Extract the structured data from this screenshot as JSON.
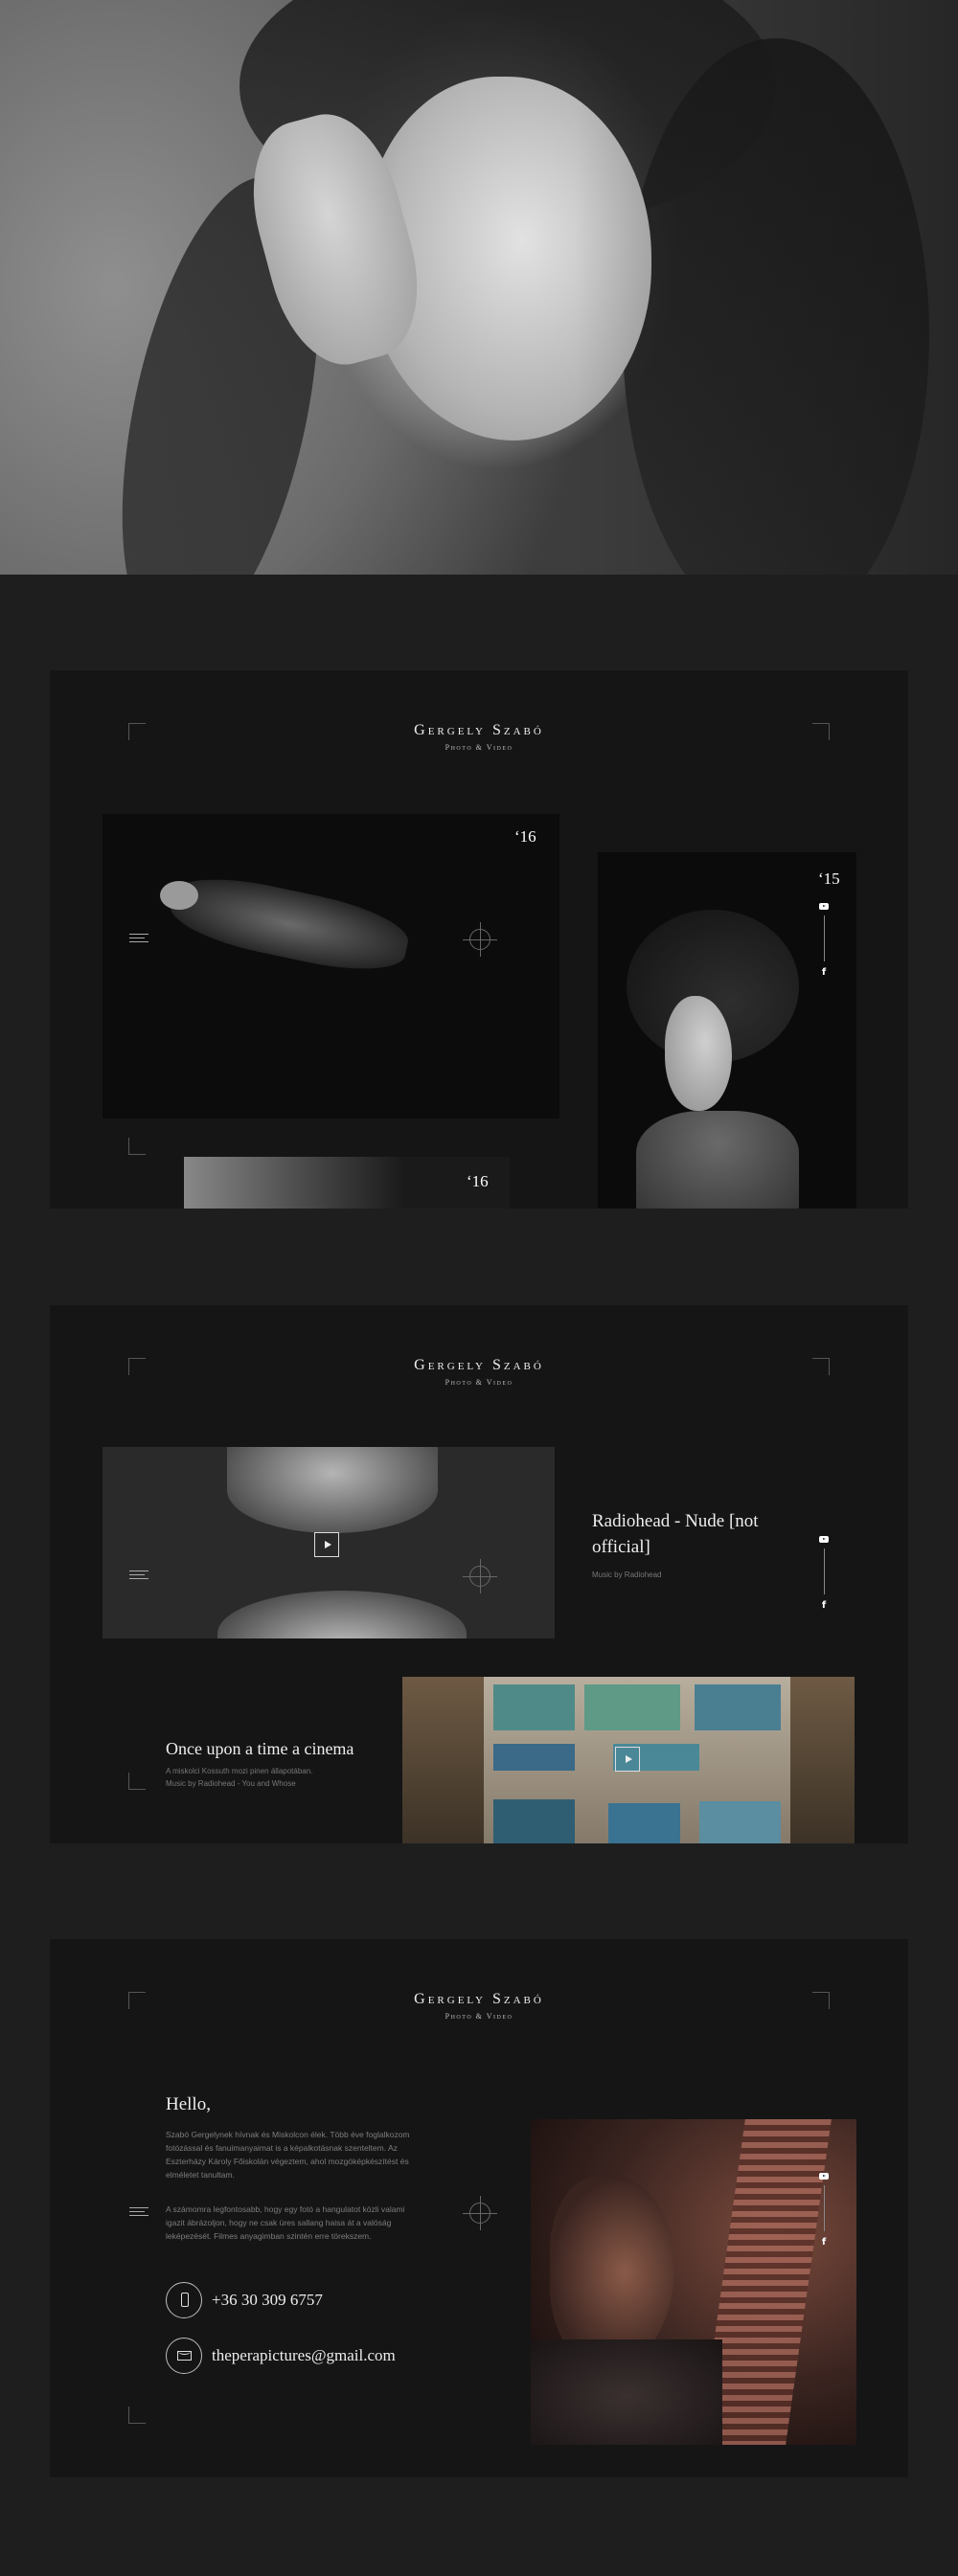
{
  "brand": {
    "name": "Gergely Szabó",
    "subtitle": "Photo & Video"
  },
  "gallery": {
    "card1_year": "‘16",
    "card2_year": "‘15",
    "card3_year": "‘16"
  },
  "videos": {
    "item1": {
      "title": "Radiohead - Nude [not official]",
      "credit": "Music by Radiohead"
    },
    "item2": {
      "title": "Once upon a time a cinema",
      "line1": "A miskolci Kossuth mozi pinen állapotában.",
      "line2": "Music by Radiohead - You and Whose"
    }
  },
  "about": {
    "greeting": "Hello,",
    "para1_l1": "Szabó Gergelynek hívnak és Miskolcon élek. Több éve foglalkozom",
    "para1_l2": "fotózással és fanuimanyaimat is a képalkotásnak szenteltem. Az",
    "para1_l3": "Eszterházy Károly Főiskolán végeztem, ahol mozgóképkészítést és",
    "para1_l4": "elméletet tanultam.",
    "para2_l1": "A számomra legfontosabb, hogy egy fotó a hangulatot közli valami",
    "para2_l2": "igazit ábrázoljon, hogy ne csak üres sallang haisa át a valóság",
    "para2_l3": "leképezését. Filmes anyagimban szintén erre törekszem.",
    "phone": "+36 30 309 6757",
    "email": "theperapictures@gmail.com"
  },
  "icons": {
    "menu": "menu-icon",
    "youtube": "youtube-icon",
    "facebook": "facebook-icon",
    "phone": "phone-icon",
    "mail": "mail-icon",
    "play": "play-icon"
  },
  "colors": {
    "background": "#1e1e1e",
    "panel": "#151515",
    "text": "#ffffff",
    "muted": "#7d7d7d"
  }
}
